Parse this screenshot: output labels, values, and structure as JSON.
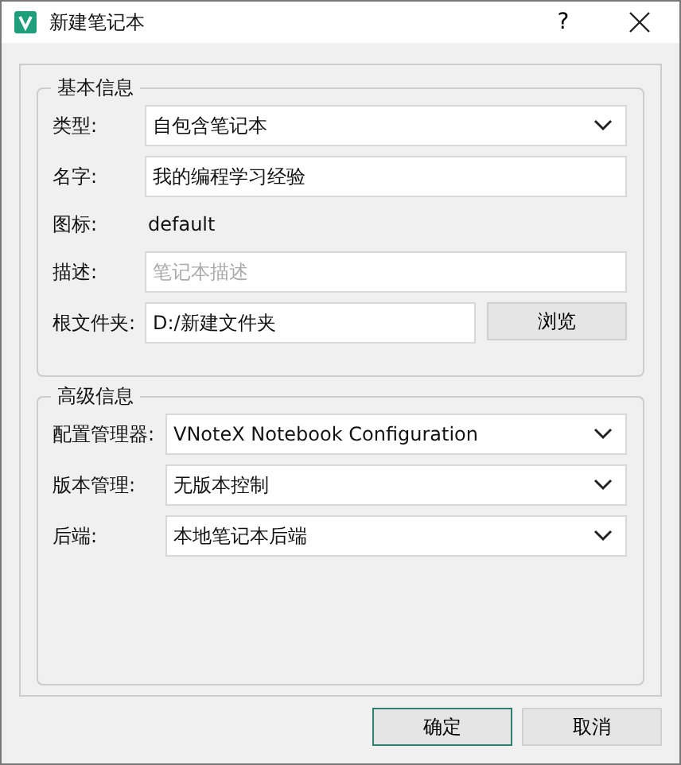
{
  "window": {
    "title": "新建笔记本",
    "help": "?"
  },
  "basic": {
    "title": "基本信息",
    "rows": [
      {
        "kind": "select",
        "label": "类型:",
        "value": "自包含笔记本"
      },
      {
        "kind": "input",
        "label": "名字:",
        "value": "我的编程学习经验"
      },
      {
        "kind": "text",
        "label": "图标:",
        "value": "default"
      },
      {
        "kind": "input",
        "label": "描述:",
        "placeholder": "笔记本描述"
      },
      {
        "kind": "browse",
        "label": "根文件夹:",
        "value": "D:/新建文件夹",
        "button": "浏览"
      }
    ]
  },
  "advanced": {
    "title": "高级信息",
    "rows": [
      {
        "kind": "select",
        "label": "配置管理器:",
        "value": "VNoteX Notebook Configuration"
      },
      {
        "kind": "select",
        "label": "版本管理:",
        "value": "无版本控制"
      },
      {
        "kind": "select",
        "label": "后端:",
        "value": "本地笔记本后端"
      }
    ]
  },
  "buttons": [
    "确定",
    "取消"
  ]
}
